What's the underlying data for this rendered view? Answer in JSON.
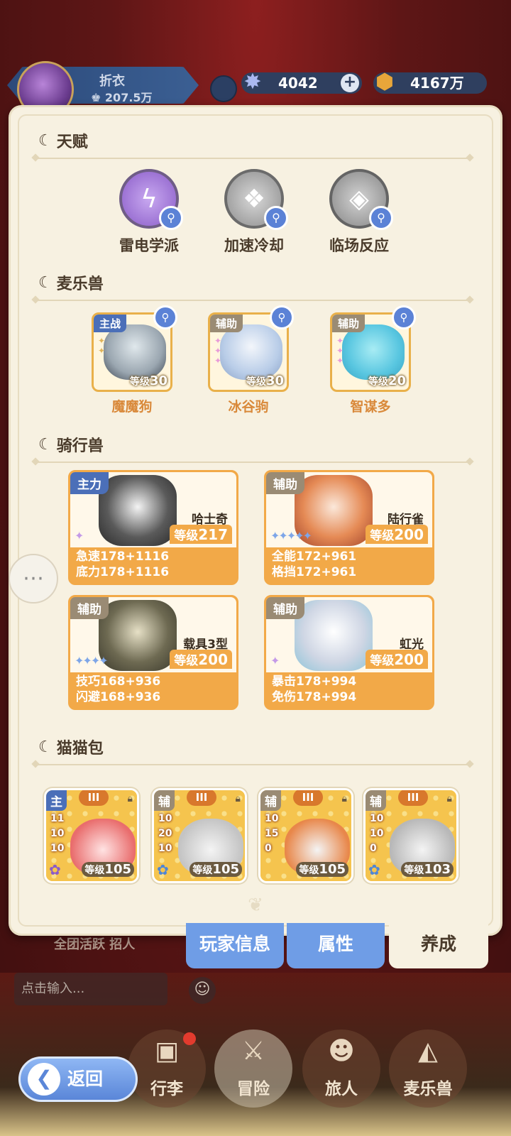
{
  "header": {
    "player_name": "折衣",
    "player_power": "207.5万",
    "gems": "4042",
    "gold": "4167万"
  },
  "sections": {
    "talent": "天赋",
    "pets": "麦乐兽",
    "mounts": "骑行兽",
    "cats": "猫猫包"
  },
  "talents": [
    {
      "name": "雷电学派",
      "icon": "lightning-icon"
    },
    {
      "name": "加速冷却",
      "icon": "crystal-icon"
    },
    {
      "name": "临场反应",
      "icon": "diamond-icon"
    }
  ],
  "pets": [
    {
      "role": "主战",
      "level_prefix": "等级",
      "level": "30",
      "name": "魔魔狗"
    },
    {
      "role": "辅助",
      "level_prefix": "等级",
      "level": "30",
      "name": "冰谷驹"
    },
    {
      "role": "辅助",
      "level_prefix": "等级",
      "level": "20",
      "name": "智谋多"
    }
  ],
  "mounts": [
    {
      "role": "主力",
      "name": "哈士奇",
      "level_prefix": "等级",
      "level": "217",
      "stat1": "急速178+1116",
      "stat2": "底力178+1116"
    },
    {
      "role": "辅助",
      "name": "陆行雀",
      "level_prefix": "等级",
      "level": "200",
      "stat1": "全能172+961",
      "stat2": "格挡172+961"
    },
    {
      "role": "辅助",
      "name": "载具3型",
      "level_prefix": "等级",
      "level": "200",
      "stat1": "技巧168+936",
      "stat2": "闪避168+936"
    },
    {
      "role": "辅助",
      "name": "虹光",
      "level_prefix": "等级",
      "level": "200",
      "stat1": "暴击178+994",
      "stat2": "免伤178+994"
    }
  ],
  "cats": [
    {
      "role": "主",
      "tier": "III",
      "n1": "11",
      "n2": "10",
      "n3": "10",
      "level_prefix": "等级",
      "level": "105"
    },
    {
      "role": "辅",
      "tier": "III",
      "n1": "10",
      "n2": "20",
      "n3": "10",
      "level_prefix": "等级",
      "level": "105"
    },
    {
      "role": "辅",
      "tier": "III",
      "n1": "10",
      "n2": "15",
      "n3": "0",
      "level_prefix": "等级",
      "level": "105"
    },
    {
      "role": "辅",
      "tier": "III",
      "n1": "10",
      "n2": "10",
      "n3": "0",
      "level_prefix": "等级",
      "level": "103"
    }
  ],
  "tabs": {
    "info": "玩家信息",
    "attr": "属性",
    "dev": "养成"
  },
  "chat": {
    "links": "全团活跃  招人  ",
    "placeholder": "点击输入..."
  },
  "nav": {
    "bag": "行李",
    "adventure": "冒险",
    "traveler": "旅人",
    "pets": "麦乐兽",
    "back": "返回"
  },
  "colors": {
    "accent_blue": "#6f9de6",
    "orange": "#f2a948",
    "panel_bg": "#f7f1e1"
  }
}
